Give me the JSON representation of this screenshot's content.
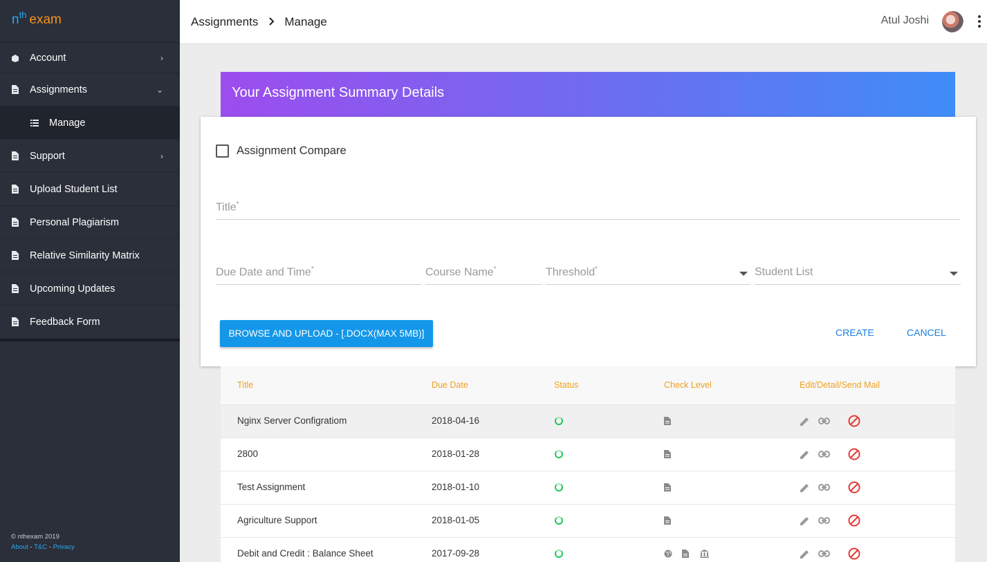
{
  "logo": {
    "n": "n",
    "th": "th",
    "exam": "exam"
  },
  "sidebar": {
    "items": [
      {
        "label": "Account",
        "icon": "account-icon",
        "chevron": "right"
      },
      {
        "label": "Assignments",
        "icon": "document-icon",
        "chevron": "down"
      },
      {
        "label": "Manage",
        "icon": "list-icon",
        "sub": true
      },
      {
        "label": "Support",
        "icon": "document-icon",
        "chevron": "right"
      },
      {
        "label": "Upload Student List",
        "icon": "document-icon"
      },
      {
        "label": "Personal Plagiarism",
        "icon": "document-icon"
      },
      {
        "label": "Relative Similarity Matrix",
        "icon": "document-icon"
      },
      {
        "label": "Upcoming Updates",
        "icon": "document-icon"
      },
      {
        "label": "Feedback Form",
        "icon": "document-icon"
      }
    ],
    "footer": {
      "copyright": "© nthexam 2019",
      "about": "About",
      "tc": "T&C",
      "privacy": "Privacy",
      "sep": " - "
    }
  },
  "topbar": {
    "breadcrumb": [
      "Assignments",
      "Manage"
    ],
    "user_name": "Atul Joshi"
  },
  "banner": {
    "title": "Your Assignment Summary Details"
  },
  "form": {
    "compare_label": "Assignment Compare",
    "title_label": "Title",
    "due_label": "Due Date and Time",
    "course_label": "Course Name",
    "threshold_label": "Threshold",
    "student_list_label": "Student List",
    "required_mark": "*",
    "upload_label": "BROWSE AND UPLOAD - [.DOCX(MAX 5MB)]",
    "create_label": "CREATE",
    "cancel_label": "CANCEL"
  },
  "table": {
    "headers": [
      "Title",
      "Due Date",
      "Status",
      "Check Level",
      "Edit/Detail/Send Mail"
    ],
    "rows": [
      {
        "title": "Nginx Server Configratiom",
        "due": "2018-04-16",
        "check": [
          "document-icon"
        ]
      },
      {
        "title": "2800",
        "due": "2018-01-28",
        "check": [
          "document-icon"
        ]
      },
      {
        "title": "Test Assignment",
        "due": "2018-01-10",
        "check": [
          "document-icon"
        ]
      },
      {
        "title": "Agriculture Support",
        "due": "2018-01-05",
        "check": [
          "document-icon"
        ]
      },
      {
        "title": "Debit and Credit : Balance Sheet",
        "due": "2017-09-28",
        "check": [
          "globe-icon",
          "document-icon",
          "institution-icon"
        ]
      }
    ]
  },
  "colors": {
    "accent": "#1497e8",
    "orange": "#f0a01e",
    "status": "#22c55e",
    "delete": "#e53935",
    "sidebar": "#2a2f3a"
  }
}
